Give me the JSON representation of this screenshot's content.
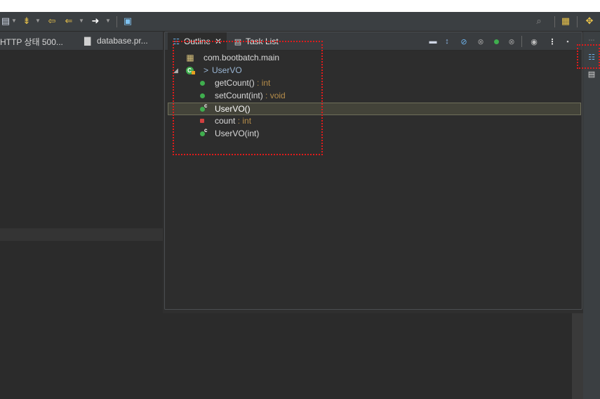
{
  "toolbar": {
    "icons": [
      "navigate-icon",
      "nav-back-icon",
      "prev-annotation-icon",
      "back-icon",
      "forward-icon",
      "open-task-icon",
      "search-icon",
      "open-perspective-icon",
      "java-perspective-icon"
    ]
  },
  "editor": {
    "tabs": [
      {
        "label": "HTTP 상태 500..."
      },
      {
        "label": "database.pr..."
      }
    ]
  },
  "outline": {
    "tabs": [
      {
        "label": "Outline",
        "close": "✕",
        "active": true
      },
      {
        "label": "Task List",
        "active": false
      }
    ],
    "toolbar_icons": [
      "collapse-all-icon",
      "sort-icon",
      "hide-fields-icon",
      "hide-static-icon",
      "hide-nonpublic-icon",
      "hide-local-types-icon",
      "focus-icon",
      "view-menu-icon",
      "minimize-icon"
    ],
    "tree": [
      {
        "label": "com.bootbatch.main",
        "type": "",
        "icon": "package-icon"
      },
      {
        "label": "UserVO",
        "prefix": ">",
        "type": "",
        "icon": "class-icon"
      },
      {
        "label": "getCount()",
        "type": " : int",
        "icon": "public-method-icon"
      },
      {
        "label": "setCount(int)",
        "type": " : void",
        "icon": "public-method-icon"
      },
      {
        "label": "UserVO()",
        "type": "",
        "icon": "constructor-icon",
        "selected": true
      },
      {
        "label": "count",
        "type": " : int",
        "icon": "private-field-icon"
      },
      {
        "label": "UserVO(int)",
        "type": "",
        "icon": "constructor-icon"
      }
    ]
  },
  "colors": {
    "annotation": "#e01b1b",
    "type_text": "#b48c4a",
    "public_member": "#3fae4e",
    "private_member": "#d04040"
  }
}
